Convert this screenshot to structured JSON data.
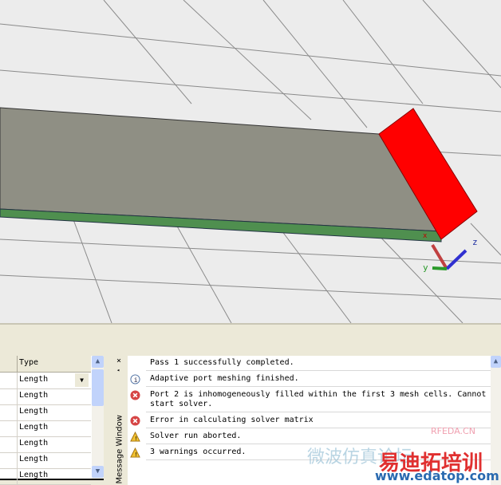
{
  "view3d": {
    "axes": {
      "x": "x",
      "y": "y",
      "z": "z"
    },
    "port_color": "#ff0000",
    "board_color": "#8f8f84"
  },
  "table": {
    "header": "Type",
    "rows": [
      "Length",
      "Length",
      "Length",
      "Length",
      "Length",
      "Length",
      "Length"
    ]
  },
  "message_window": {
    "title": "Message Window",
    "close": "×",
    "pin": "◂",
    "messages": [
      {
        "icon": "none",
        "text": "Pass 1 successfully completed."
      },
      {
        "icon": "info-icon",
        "text": "Adaptive port meshing finished."
      },
      {
        "icon": "error-icon",
        "text": "Port 2 is inhomogeneously filled within the first 3 mesh cells. Cannot start solver."
      },
      {
        "icon": "error-icon",
        "text": "Error in calculating solver matrix"
      },
      {
        "icon": "warning-icon",
        "text": "Solver run aborted."
      },
      {
        "icon": "warning-icon",
        "text": "3 warnings occurred."
      }
    ]
  },
  "watermark": {
    "site1": "RFEDA.CN",
    "cn1": "微波仿真论坛",
    "cn2": "易迪拓培训",
    "url": "www.edatop.com"
  }
}
